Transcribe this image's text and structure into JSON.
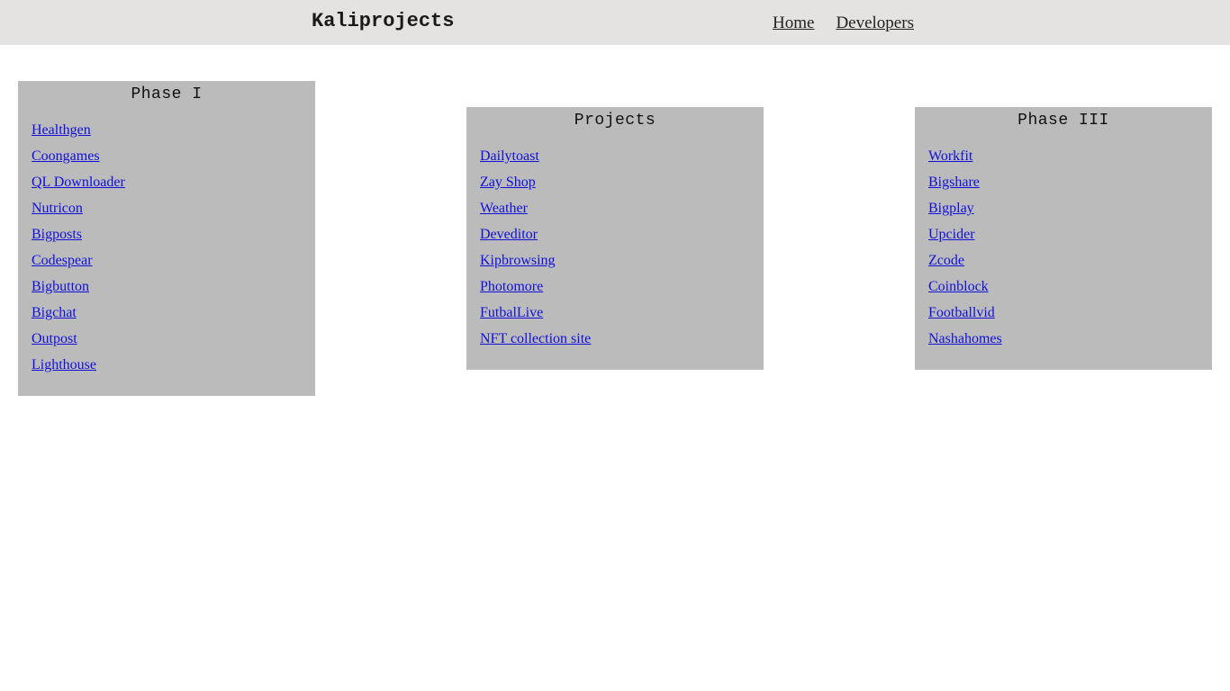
{
  "header": {
    "brand": "Kaliprojects",
    "nav": [
      {
        "label": "Home"
      },
      {
        "label": "Developers"
      }
    ]
  },
  "panels": [
    {
      "title": "Phase I",
      "links": [
        "Healthgen",
        "Coongames",
        "QL Downloader",
        "Nutricon",
        "Bigposts",
        "Codespear",
        "Bigbutton",
        "Bigchat",
        "Outpost",
        "Lighthouse"
      ]
    },
    {
      "title": "Projects",
      "links": [
        "Dailytoast",
        "Zay Shop",
        "Weather",
        "Deveditor",
        "Kipbrowsing",
        "Photomore",
        "FutbalLive",
        "NFT collection site"
      ]
    },
    {
      "title": "Phase III",
      "links": [
        "Workfit",
        "Bigshare",
        "Bigplay",
        "Upcider",
        "Zcode",
        "Coinblock",
        "Footballvid",
        "Nashahomes"
      ]
    }
  ],
  "colors": {
    "header_bg": "#e4e3e2",
    "panel_bg": "#bcbbbc",
    "link": "#1010d8"
  }
}
